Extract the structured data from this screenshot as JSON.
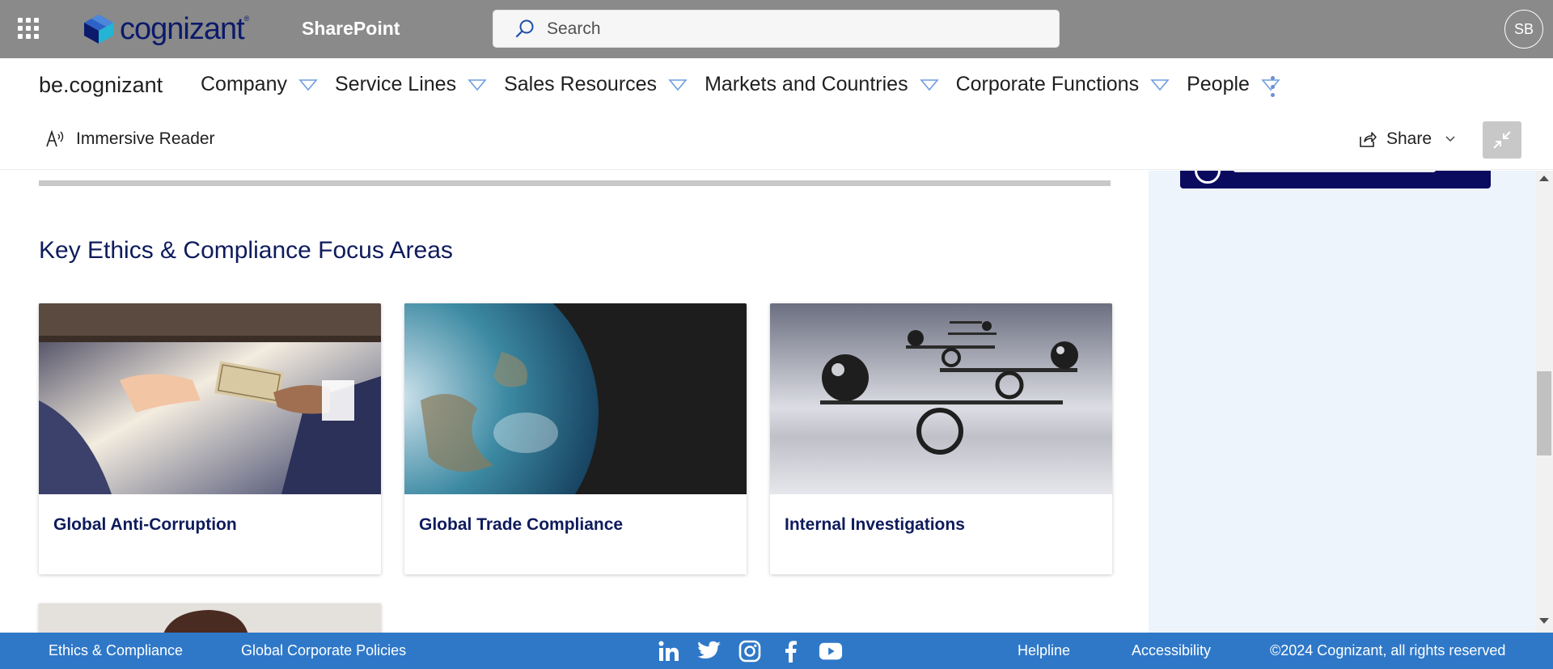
{
  "suite_bar": {
    "logo_text": "cognizant",
    "logo_tm": "®",
    "app_title": "SharePoint",
    "search_placeholder": "Search",
    "avatar_initials": "SB"
  },
  "site_nav": {
    "site_name": "be.cognizant",
    "items": [
      {
        "label": "Company"
      },
      {
        "label": "Service Lines"
      },
      {
        "label": "Sales Resources"
      },
      {
        "label": "Markets and Countries"
      },
      {
        "label": "Corporate Functions"
      },
      {
        "label": "People"
      }
    ]
  },
  "command_bar": {
    "immersive_reader": "Immersive Reader",
    "share": "Share"
  },
  "main": {
    "section_title": "Key Ethics & Compliance Focus Areas",
    "cards": [
      {
        "label": "Global Anti-Corruption",
        "image": "handing-money-photo"
      },
      {
        "label": "Global Trade Compliance",
        "image": "earth-globe-photo"
      },
      {
        "label": "Internal Investigations",
        "image": "balance-spheres-photo"
      }
    ]
  },
  "footer": {
    "links_left": [
      "Ethics & Compliance",
      "Global Corporate Policies"
    ],
    "socials": [
      "linkedin-icon",
      "twitter-icon",
      "instagram-icon",
      "facebook-icon",
      "youtube-icon"
    ],
    "links_right": [
      "Helpline",
      "Accessibility"
    ],
    "copyright": "©2024 Cognizant, all rights reserved"
  },
  "colors": {
    "suite_bar": "#8a8a8a",
    "brand_navy": "#0e1b5c",
    "footer_blue": "#2f78c8",
    "right_panel": "#eef4fb"
  }
}
